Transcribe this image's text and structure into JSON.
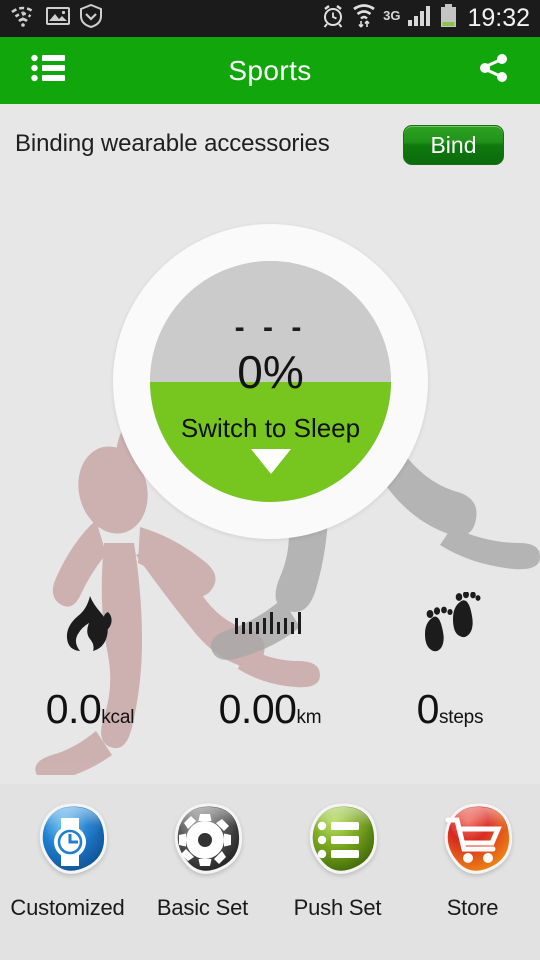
{
  "statusbar": {
    "left_icons": [
      "wifi-question-icon",
      "gallery-image-icon",
      "shield-chevron-icon"
    ],
    "right_icons": [
      "alarm-clock-icon",
      "wifi-transfer-icon",
      "signal-bars-icon",
      "battery-icon"
    ],
    "network_label": "3G",
    "clock": "19:32",
    "background_color": "#1b1b1b",
    "battery_fill_color": "#8bc34a"
  },
  "appbar": {
    "title": "Sports",
    "menu_icon": "list-menu-icon",
    "share_icon": "share-icon",
    "background_color": "#11a70c"
  },
  "bind_row": {
    "label": "Binding wearable accessories",
    "button_label": "Bind",
    "button_color": "#19901a"
  },
  "dial": {
    "top_value": "- - -",
    "percent": "0%",
    "action_label": "Switch to Sleep",
    "caret_icon": "chevron-down-triangle-icon",
    "gray_color": "#cbcbcb",
    "green_color": "#77c61f",
    "ring_color": "#fafafa"
  },
  "stats": [
    {
      "icon": "flame-icon",
      "value": "0.0",
      "unit": "kcal"
    },
    {
      "icon": "ruler-icon",
      "value": "0.00",
      "unit": "km"
    },
    {
      "icon": "footprints-icon",
      "value": "0",
      "unit": "steps"
    }
  ],
  "bottom_tiles": [
    {
      "label": "Customized",
      "icon": "watch-clock-icon",
      "color": "#1f7fd0"
    },
    {
      "label": "Basic Set",
      "icon": "gear-icon",
      "color": "#4a4a4a"
    },
    {
      "label": "Push Set",
      "icon": "list-icon",
      "color": "#7aa81e"
    },
    {
      "label": "Store",
      "icon": "shopping-cart-icon",
      "color": "#d8281f"
    }
  ],
  "background": {
    "page_color": "#e7e7e7",
    "runner_left_color": "rgba(184,140,140,0.55)",
    "runner_right_color": "rgba(130,130,130,0.45)"
  }
}
